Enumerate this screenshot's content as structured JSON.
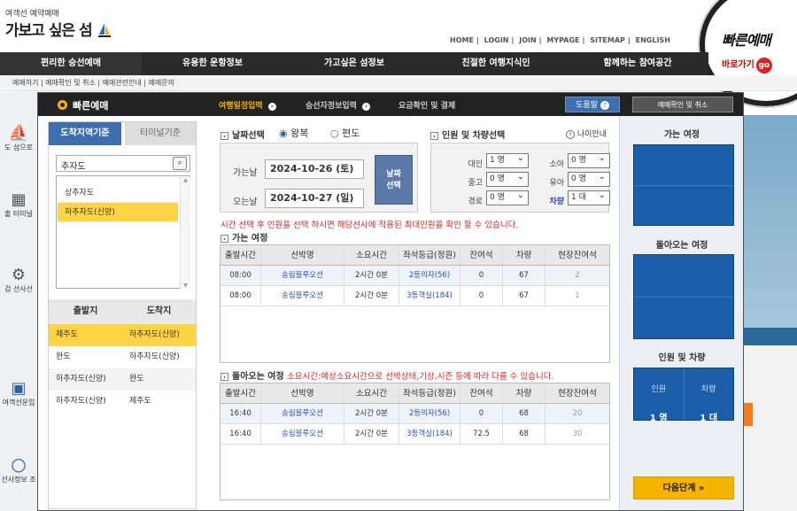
{
  "header": {
    "tagline": "여객선 예약예매",
    "logo": "가보고 싶은 섬",
    "top_links": [
      "HOME",
      "LOGIN",
      "JOIN",
      "MYPAGE",
      "SITEMAP",
      "ENGLISH"
    ],
    "quick_title": "빠른예매",
    "quick_go": "바로가기",
    "quick_go_badge": "go"
  },
  "main_nav": [
    "편리한 승선예매",
    "유용한 운항정보",
    "가고싶은 섬정보",
    "친절한 여행지식인",
    "함께하는 참여공간"
  ],
  "sub_nav": [
    "예매하기",
    "예매확인 및 취소",
    "예매관련안내",
    "예매문의"
  ],
  "side_bg": {
    "items": [
      "도 섬으로",
      "출 터미널",
      "검 선사선",
      "여객선운임",
      "선사정보 조"
    ]
  },
  "modal": {
    "title": "빠른예매",
    "steps": [
      {
        "label": "여행일정입력",
        "active": true
      },
      {
        "label": "승선자정보입력",
        "active": false
      },
      {
        "label": "요금확인 및 결제",
        "active": false
      }
    ],
    "help_label": "도움말",
    "help_icon": "?",
    "resv_label": "예매확인 및 취소"
  },
  "left": {
    "tab_region": "도착지역기준",
    "tab_terminal": "터미널기준",
    "search_value": "추자도",
    "regions": [
      {
        "name": "상추자도",
        "selected": false
      },
      {
        "name": "하추자도(신양)",
        "selected": true
      }
    ],
    "route_headers": [
      "출발지",
      "도착지"
    ],
    "routes": [
      {
        "from": "제주도",
        "to": "하추자도(신양)",
        "selected": true
      },
      {
        "from": "완도",
        "to": "하추자도(신양)",
        "selected": false
      },
      {
        "from": "하추자도(신양)",
        "to": "완도",
        "selected": false
      },
      {
        "from": "하추자도(신양)",
        "to": "제주도",
        "selected": false
      }
    ]
  },
  "date": {
    "section": "날짜선택",
    "round_trip": "왕복",
    "one_way": "편도",
    "depart_label": "가는날",
    "depart_value": "2024-10-26 (토)",
    "return_label": "오는날",
    "return_value": "2024-10-27 (일)",
    "pick_label_1": "날짜",
    "pick_label_2": "선택"
  },
  "pax": {
    "section": "인원 및 차량선택",
    "age_guide": "나이안내",
    "age_icon": "!",
    "fields": [
      {
        "label": "대인",
        "value": "1 명"
      },
      {
        "label": "소아",
        "value": "0 명"
      },
      {
        "label": "중고",
        "value": "0 명"
      },
      {
        "label": "유아",
        "value": "0 명"
      },
      {
        "label": "경로",
        "value": "0 명"
      },
      {
        "label": "차량",
        "value": "1 대"
      }
    ]
  },
  "notice": "시간 선택 후 인원을 선택 하시면 해당선사에 적용된 최대인원을 확인 할 수 있습니다.",
  "table_headers": [
    "출발시간",
    "선박명",
    "소요시간",
    "좌석등급(정원)",
    "잔여석",
    "차량",
    "현장잔여석"
  ],
  "outbound": {
    "title": "가는 여정",
    "rows": [
      {
        "time": "08:00",
        "ship": "송림블루오션",
        "dur": "2시간 0분",
        "grade": "2등의자(56)",
        "remain": "0",
        "car": "67",
        "site": "2"
      },
      {
        "time": "08:00",
        "ship": "송림블루오션",
        "dur": "2시간 0분",
        "grade": "3등객실(184)",
        "remain": "0",
        "car": "67",
        "site": "1"
      }
    ]
  },
  "inbound": {
    "title": "돌아오는 여정",
    "note": "소요시간:예상소요시간으로 선박상태,기상,시즌 등에 따라 다를 수 있습니다.",
    "rows": [
      {
        "time": "16:40",
        "ship": "송림블루오션",
        "dur": "2시간 0분",
        "grade": "2등의자(56)",
        "remain": "0",
        "car": "68",
        "site": "20"
      },
      {
        "time": "16:40",
        "ship": "송림블루오션",
        "dur": "2시간 0분",
        "grade": "3등객실(184)",
        "remain": "72.5",
        "car": "68",
        "site": "30"
      }
    ]
  },
  "right": {
    "out_title": "가는 여정",
    "back_title": "돌아오는 여정",
    "pax_title": "인원 및 차량",
    "pax_label": "인원",
    "pax_value": "1 명",
    "car_label": "차량",
    "car_value": "1 대",
    "next_label": "다음단계",
    "next_icon": "»"
  },
  "colors": {
    "accent": "#f4b400",
    "brand_blue": "#3d6fae",
    "selected_row": "#ffd444",
    "warning": "#dd2222"
  }
}
